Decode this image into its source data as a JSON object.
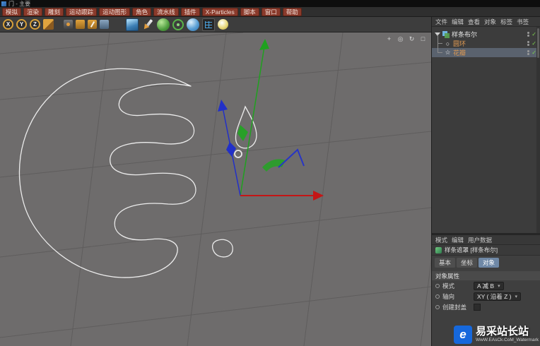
{
  "window": {
    "title": "门 - 主要"
  },
  "menubar": {
    "items": [
      "模拟",
      "渲染",
      "雕刻",
      "运动跟踪",
      "运动图形",
      "角色",
      "流水线",
      "插件",
      "X-Particles",
      "脚本",
      "窗口",
      "帮助"
    ]
  },
  "toolbar": {
    "axis_buttons": [
      {
        "label": "X"
      },
      {
        "label": "Y"
      },
      {
        "label": "Z"
      }
    ]
  },
  "viewport": {
    "view_controls": [
      {
        "name": "pan-view",
        "glyph": "+"
      },
      {
        "name": "zoom-view",
        "glyph": "◎"
      },
      {
        "name": "rotate-view",
        "glyph": "↻"
      },
      {
        "name": "maximize-view",
        "glyph": "□"
      }
    ]
  },
  "object_manager": {
    "menus": [
      "文件",
      "编辑",
      "查看",
      "对象",
      "标签",
      "书签"
    ],
    "objects": [
      {
        "label": "样条布尔",
        "icon": "spline-boolean-icon",
        "icon_glyph": ""
      },
      {
        "label": "圆环",
        "icon": "circle-spline-icon",
        "icon_glyph": "○"
      },
      {
        "label": "花瓣",
        "icon": "flower-spline-icon",
        "icon_glyph": "☆"
      }
    ]
  },
  "attributes": {
    "menus": [
      "模式",
      "编辑",
      "用户数据"
    ],
    "title": "样条遮罩 [样条布尔]",
    "tabs": [
      "基本",
      "坐标",
      "对象"
    ],
    "active_tab": "对象",
    "section_title": "对象属性",
    "fields": [
      {
        "label": "模式",
        "value": "A 减 B",
        "type": "dropdown"
      },
      {
        "label": "轴向",
        "value": "XY ( 沿着 Z )",
        "type": "dropdown"
      },
      {
        "label": "创建封盖",
        "value": "",
        "type": "checkbox"
      }
    ]
  },
  "watermark": {
    "icon_glyph": "e",
    "brand": "易采站长站",
    "subtext": "WwW.EAsCk.CoM_Watermark"
  },
  "colors": {
    "axis_x": "#c41616",
    "axis_y": "#1fa11f",
    "axis_z": "#2230c8",
    "selection_blue": "#6f88a6",
    "menu_red": "#8a3a2b"
  }
}
